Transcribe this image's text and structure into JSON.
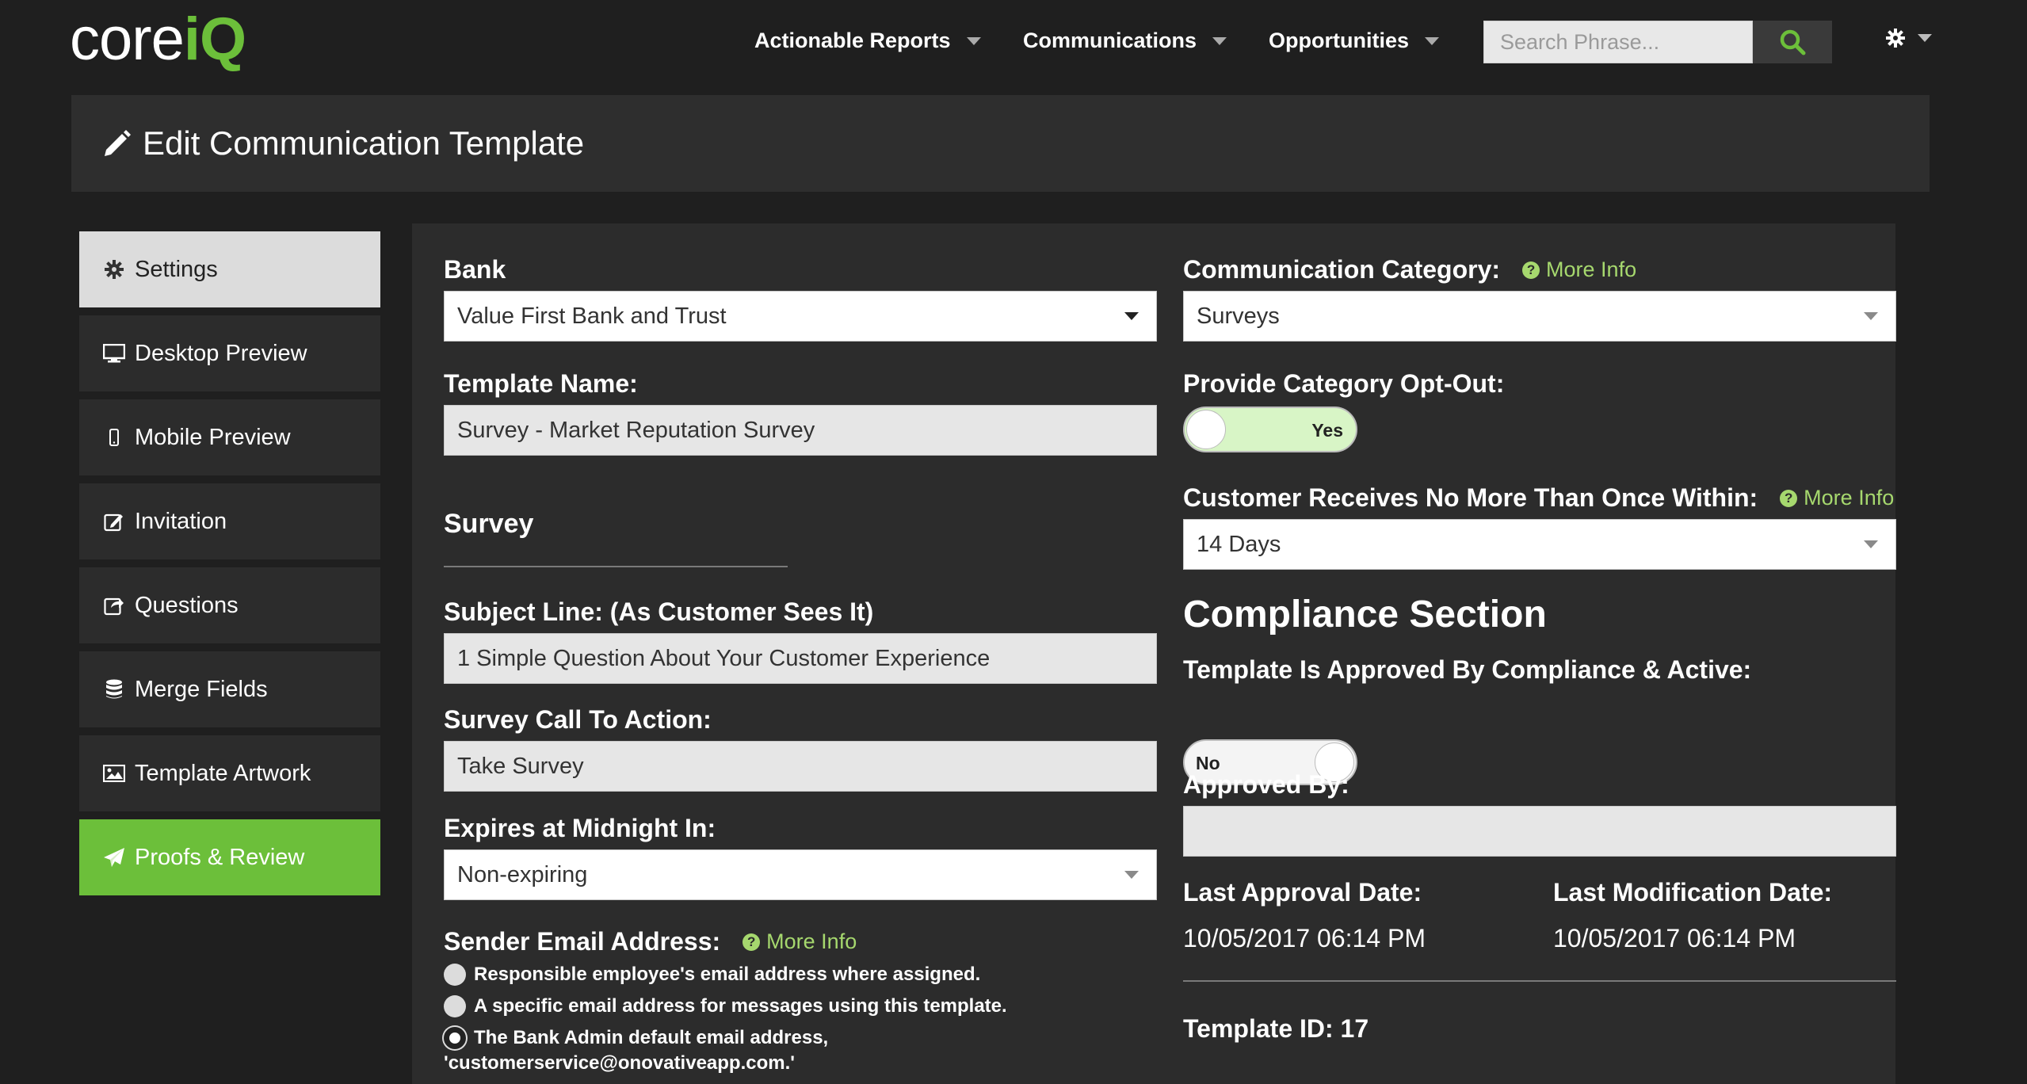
{
  "brand": {
    "logo_core": "core",
    "logo_iq": "iQ"
  },
  "nav": {
    "items": [
      {
        "label": "Actionable Reports"
      },
      {
        "label": "Communications"
      },
      {
        "label": "Opportunities"
      }
    ],
    "search": {
      "placeholder": "Search Phrase..."
    }
  },
  "page": {
    "title": "Edit Communication Template"
  },
  "sidebar": {
    "items": [
      {
        "label": "Settings",
        "icon": "gear-icon",
        "state": "active"
      },
      {
        "label": "Desktop Preview",
        "icon": "desktop-icon"
      },
      {
        "label": "Mobile Preview",
        "icon": "mobile-icon"
      },
      {
        "label": "Invitation",
        "icon": "edit-icon"
      },
      {
        "label": "Questions",
        "icon": "share-icon"
      },
      {
        "label": "Merge Fields",
        "icon": "database-icon"
      },
      {
        "label": "Template Artwork",
        "icon": "image-icon"
      },
      {
        "label": "Proofs & Review",
        "icon": "send-icon",
        "state": "highlight"
      }
    ]
  },
  "form": {
    "bank": {
      "label": "Bank",
      "value": "Value First Bank and Trust"
    },
    "template_name": {
      "label": "Template Name:",
      "value": "Survey - Market Reputation Survey"
    },
    "survey_section": "Survey",
    "subject_line": {
      "label": "Subject Line: (As Customer Sees It)",
      "value": "1 Simple Question About Your Customer Experience"
    },
    "call_to_action": {
      "label": "Survey Call To Action:",
      "value": "Take Survey"
    },
    "expires": {
      "label": "Expires at Midnight In:",
      "value": "Non-expiring"
    },
    "sender": {
      "label": "Sender Email Address:",
      "more_info": "More Info",
      "options": [
        {
          "label": "Responsible employee's email address where assigned.",
          "checked": false
        },
        {
          "label": "A specific email address for messages using this template.",
          "checked": false
        },
        {
          "label": "The Bank Admin default email address,",
          "label_line2": "'customerservice@onovativeapp.com.'",
          "checked": true
        }
      ]
    },
    "category": {
      "label": "Communication Category:",
      "more_info": "More Info",
      "value": "Surveys"
    },
    "opt_out": {
      "label": "Provide Category Opt-Out:",
      "toggle_text": "Yes",
      "on": true
    },
    "frequency": {
      "label": "Customer Receives No More Than Once Within:",
      "more_info": "More Info",
      "value": "14 Days"
    },
    "compliance": {
      "title": "Compliance Section",
      "approved_label": "Template Is Approved By Compliance & Active:",
      "approved_toggle_text": "No",
      "approved_on": false,
      "approved_by": {
        "label": "Approved By:",
        "value": ""
      },
      "last_approval": {
        "label": "Last Approval Date:",
        "value": "10/05/2017 06:14 PM"
      },
      "last_modification": {
        "label": "Last Modification Date:",
        "value": "10/05/2017 06:14 PM"
      },
      "template_id": "Template ID: 17"
    }
  },
  "colors": {
    "accent_green": "#6cbf3a",
    "link_green": "#a6d86e",
    "background": "#1f1f1f",
    "panel": "#2c2c2c"
  }
}
